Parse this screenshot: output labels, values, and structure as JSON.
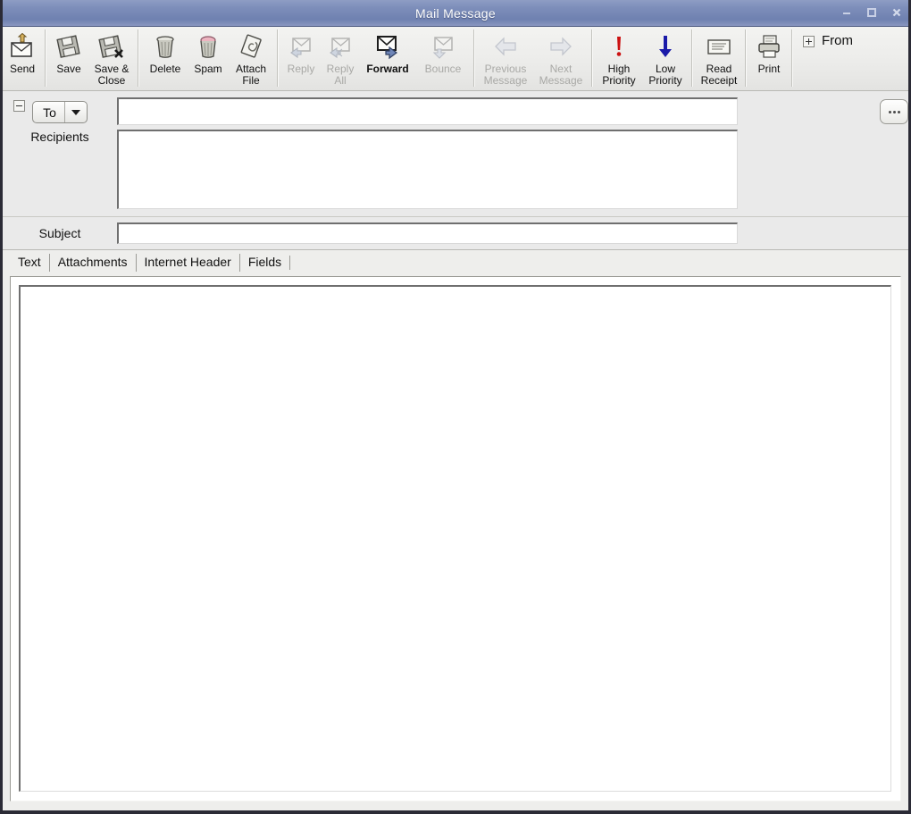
{
  "window": {
    "title": "Mail Message",
    "controls": [
      {
        "name": "minimize-button",
        "label": "Minimize"
      },
      {
        "name": "maximize-button",
        "label": "Maximize"
      },
      {
        "name": "close-button",
        "label": "Close"
      }
    ]
  },
  "toolbar": {
    "groups": [
      {
        "items": [
          {
            "label": "Send",
            "icon": "send-envelope-icon",
            "disabled": false,
            "bold": false,
            "width": "narrow"
          }
        ]
      },
      {
        "items": [
          {
            "label": "Save",
            "icon": "floppy-disk-icon",
            "disabled": false,
            "bold": false,
            "width": "narrow"
          },
          {
            "label": "Save &\nClose",
            "icon": "floppy-disk-close-icon",
            "disabled": false,
            "bold": false,
            "width": "normal"
          }
        ]
      },
      {
        "items": [
          {
            "label": "Delete",
            "icon": "trash-can-icon",
            "disabled": false,
            "bold": false,
            "width": "normal"
          },
          {
            "label": "Spam",
            "icon": "spam-can-icon",
            "disabled": false,
            "bold": false,
            "width": "narrow"
          },
          {
            "label": "Attach\nFile",
            "icon": "paperclip-page-icon",
            "disabled": false,
            "bold": false,
            "width": "normal"
          }
        ]
      },
      {
        "items": [
          {
            "label": "Reply",
            "icon": "reply-arrow-icon",
            "disabled": true,
            "bold": false,
            "width": "narrow"
          },
          {
            "label": "Reply\nAll",
            "icon": "reply-all-arrow-icon",
            "disabled": true,
            "bold": false,
            "width": "narrow"
          },
          {
            "label": "Forward",
            "icon": "forward-envelope-icon",
            "disabled": false,
            "bold": true,
            "width": "wide"
          },
          {
            "label": "Bounce",
            "icon": "bounce-envelope-icon",
            "disabled": true,
            "bold": false,
            "width": "wide"
          }
        ]
      },
      {
        "items": [
          {
            "label": "Previous\nMessage",
            "icon": "left-arrow-icon",
            "disabled": true,
            "bold": false,
            "width": "wide"
          },
          {
            "label": "Next\nMessage",
            "icon": "right-arrow-icon",
            "disabled": true,
            "bold": false,
            "width": "wide"
          }
        ]
      },
      {
        "items": [
          {
            "label": "High\nPriority",
            "icon": "exclamation-mark-icon",
            "disabled": false,
            "bold": false,
            "width": "normal"
          },
          {
            "label": "Low\nPriority",
            "icon": "down-arrow-icon",
            "disabled": false,
            "bold": false,
            "width": "normal"
          }
        ]
      },
      {
        "items": [
          {
            "label": "Read\nReceipt",
            "icon": "read-receipt-icon",
            "disabled": false,
            "bold": false,
            "width": "normal"
          }
        ]
      },
      {
        "items": [
          {
            "label": "Print",
            "icon": "printer-icon",
            "disabled": false,
            "bold": false,
            "width": "narrow"
          }
        ]
      }
    ],
    "from": {
      "expander_icon": "plus-expander-icon",
      "label": "From"
    }
  },
  "recipients": {
    "collapse_icon": "minus-collapse-icon",
    "type_button": {
      "label": "To",
      "arrow_icon": "chevron-down-icon"
    },
    "section_label": "Recipients",
    "address_value": "",
    "address_placeholder": "",
    "list_value": "",
    "list_placeholder": "",
    "browse_button": {
      "label": "...",
      "icon": "ellipsis-icon"
    }
  },
  "subject": {
    "label": "Subject",
    "value": "",
    "placeholder": ""
  },
  "tabs": {
    "items": [
      {
        "label": "Text",
        "active": true
      },
      {
        "label": "Attachments",
        "active": false
      },
      {
        "label": "Internet Header",
        "active": false
      },
      {
        "label": "Fields",
        "active": false
      }
    ]
  },
  "body": {
    "value": "",
    "placeholder": ""
  },
  "colors": {
    "titlebar_blue": "#7d8eba",
    "toolbar_bg": "#ececea",
    "panel_bg": "#eaeaea",
    "field_bg": "#ffffff",
    "disabled_text": "#a9a9a6",
    "high_priority_red": "#cc1111",
    "low_priority_blue": "#1a1aa8",
    "window_border": "#2b2b36"
  }
}
